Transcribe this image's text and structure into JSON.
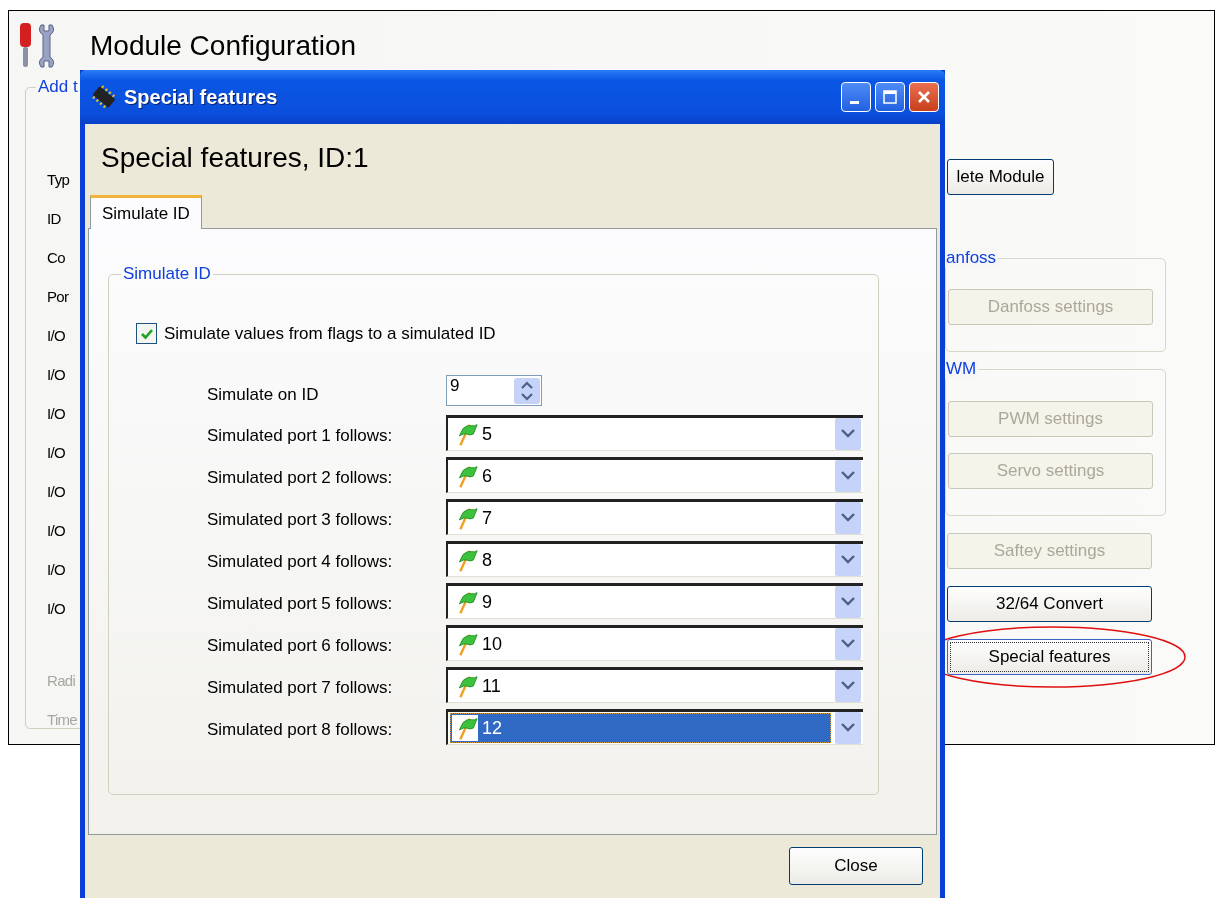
{
  "main_window": {
    "title": "Module Configuration",
    "group_title": "Add t",
    "labels": [
      {
        "text": "Typ",
        "disabled": false
      },
      {
        "text": "ID",
        "disabled": false
      },
      {
        "text": "Co",
        "disabled": false
      },
      {
        "text": "Por",
        "disabled": false
      },
      {
        "text": "I/O",
        "disabled": false
      },
      {
        "text": "I/O",
        "disabled": false
      },
      {
        "text": "I/O",
        "disabled": false
      },
      {
        "text": "I/O",
        "disabled": false
      },
      {
        "text": "I/O",
        "disabled": false
      },
      {
        "text": "I/O",
        "disabled": false
      },
      {
        "text": "I/O",
        "disabled": false
      },
      {
        "text": "I/O",
        "disabled": false
      }
    ],
    "bottom_labels": [
      {
        "text": "Radi",
        "disabled": true
      },
      {
        "text": "Time",
        "disabled": true
      }
    ],
    "right_panel": [
      {
        "kind": "button",
        "label": "lete Module",
        "disabled": false,
        "focused": false,
        "highlighted": false
      },
      {
        "kind": "group",
        "title": "anfoss",
        "buttons": [
          {
            "label": "Danfoss settings",
            "disabled": true
          }
        ]
      },
      {
        "kind": "group",
        "title": "WM",
        "buttons": [
          {
            "label": "PWM settings",
            "disabled": true
          },
          {
            "label": "Servo settings",
            "disabled": true
          }
        ]
      },
      {
        "kind": "button",
        "label": "Saftey settings",
        "disabled": true,
        "focused": false,
        "highlighted": false
      },
      {
        "kind": "button",
        "label": "32/64 Convert",
        "disabled": false,
        "focused": false,
        "highlighted": false
      },
      {
        "kind": "button",
        "label": "Special features",
        "disabled": false,
        "focused": true,
        "highlighted": true
      }
    ]
  },
  "dialog": {
    "title": "Special features",
    "heading": "Special features, ID:1",
    "tabs": [
      {
        "label": "Simulate ID",
        "selected": true
      }
    ],
    "group": {
      "title": "Simulate ID",
      "checkbox": {
        "label": "Simulate values from flags to a simulated ID",
        "checked": true
      },
      "simulate_on_id": {
        "label": "Simulate on ID",
        "value": "9"
      },
      "ports": [
        {
          "label": "Simulated port 1 follows:",
          "value": "5",
          "focused": false
        },
        {
          "label": "Simulated port 2 follows:",
          "value": "6",
          "focused": false
        },
        {
          "label": "Simulated port 3 follows:",
          "value": "7",
          "focused": false
        },
        {
          "label": "Simulated port 4 follows:",
          "value": "8",
          "focused": false
        },
        {
          "label": "Simulated port 5 follows:",
          "value": "9",
          "focused": false
        },
        {
          "label": "Simulated port 6 follows:",
          "value": "10",
          "focused": false
        },
        {
          "label": "Simulated port 7 follows:",
          "value": "11",
          "focused": false
        },
        {
          "label": "Simulated port 8 follows:",
          "value": "12",
          "focused": true
        }
      ]
    },
    "close_button": "Close"
  }
}
